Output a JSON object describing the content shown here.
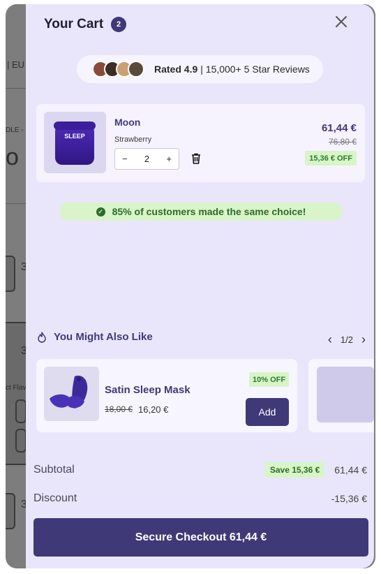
{
  "background_page": {
    "fragment_1": "| EU",
    "fragment_2": "DLE -",
    "fragment_3": "o",
    "fragment_4": "3",
    "fragment_5": "3",
    "fragment_6": "ct Flav",
    "fragment_7": "3"
  },
  "cart": {
    "title": "Your Cart",
    "count": "2",
    "close_icon": "close-icon"
  },
  "rating": {
    "strong": "Rated 4.9",
    "rest": "| 15,000+ 5 Star Reviews"
  },
  "line_item": {
    "name": "Moon",
    "variant": "Strawberry",
    "quantity": "2",
    "minus": "−",
    "plus": "+",
    "price": "61,44 €",
    "compare_price": "76,80 €",
    "discount_badge": "15,36 € OFF",
    "jar_label": "SLEEP"
  },
  "social_proof": {
    "text": "85% of customers made the same choice!"
  },
  "upsell": {
    "title": "You Might Also Like",
    "page": "1/2",
    "prev_icon": "chevron-left-icon",
    "next_icon": "chevron-right-icon",
    "items": [
      {
        "name": "Satin Sleep Mask",
        "compare_price": "18,00 €",
        "price": "16,20 €",
        "badge": "10% OFF",
        "button": "Add"
      }
    ]
  },
  "summary": {
    "subtotal_label": "Subtotal",
    "save_badge": "Save 15,36 €",
    "subtotal_value": "61,44 €",
    "discount_label": "Discount",
    "discount_value": "-15,36 €"
  },
  "checkout": {
    "label": "Secure Checkout 61,44 €"
  },
  "colors": {
    "brand": "#3f3978",
    "drawer_bg": "#e9e6fb",
    "success_bg": "#d7f5c8",
    "success_text": "#2e7c2a"
  }
}
